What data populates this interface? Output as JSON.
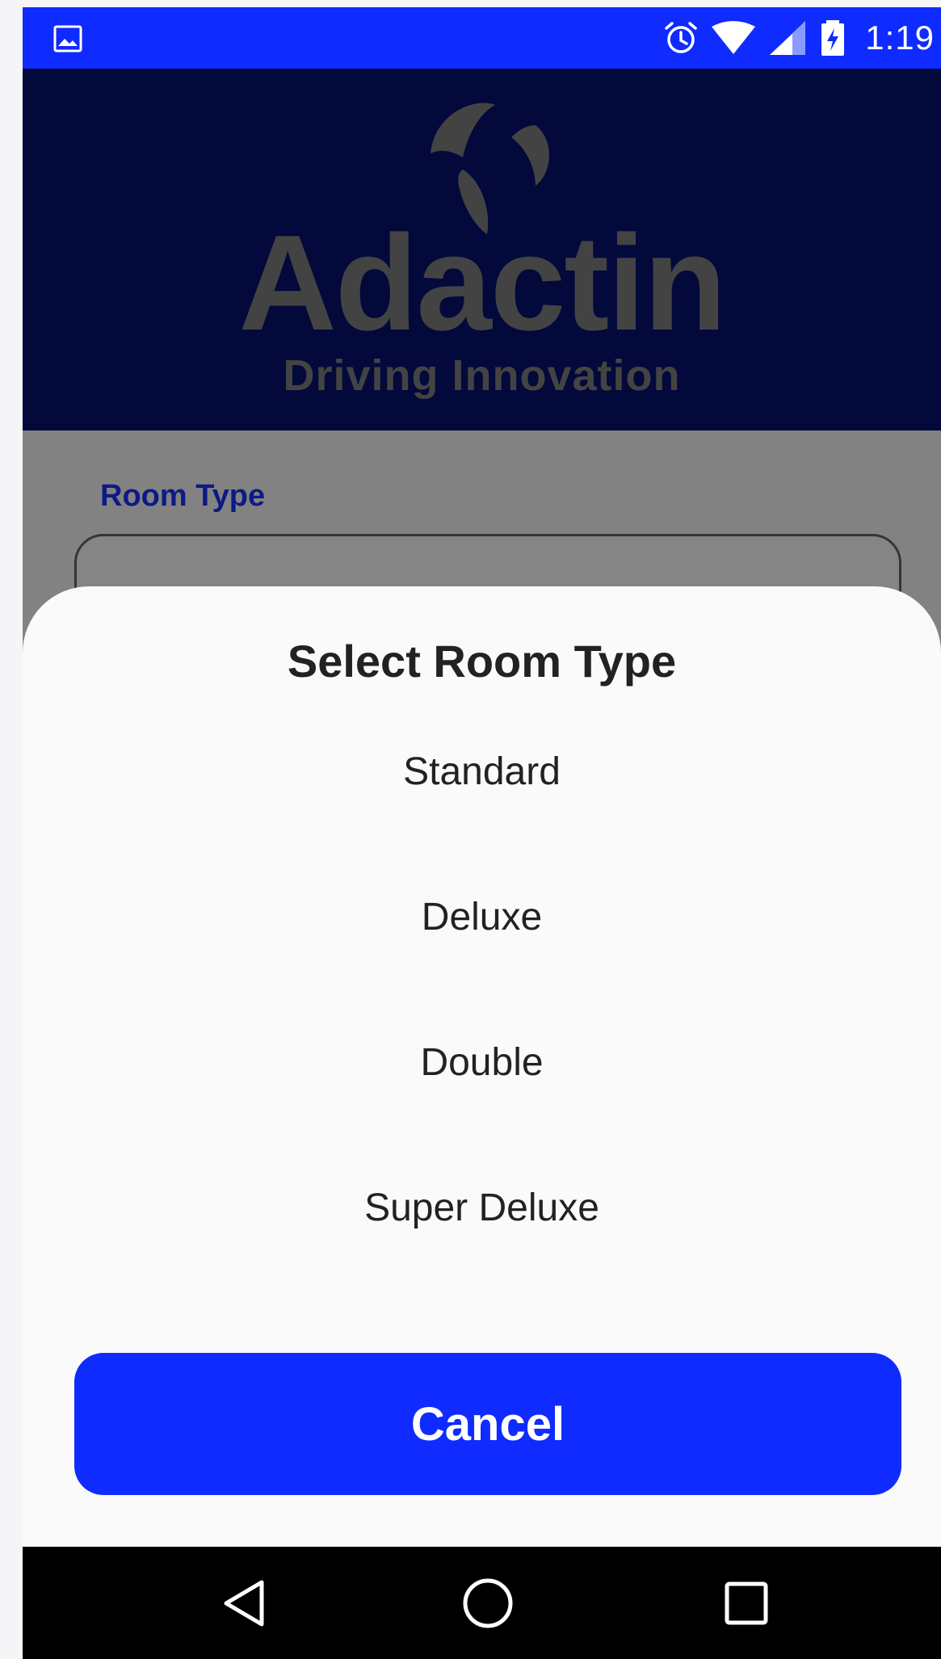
{
  "status_bar": {
    "time": "1:19",
    "icons": [
      "image-notification-icon",
      "alarm-icon",
      "wifi-icon",
      "cell-signal-icon",
      "battery-charging-icon"
    ]
  },
  "header": {
    "logo_text": "Adactin",
    "tagline": "Driving Innovation"
  },
  "form": {
    "room_type_label": "Room Type"
  },
  "sheet": {
    "title": "Select Room Type",
    "options": [
      "Standard",
      "Deluxe",
      "Double",
      "Super Deluxe"
    ],
    "cancel_label": "Cancel"
  },
  "nav_bar": {
    "icons": [
      "back-icon",
      "home-icon",
      "recents-icon"
    ]
  },
  "colors": {
    "accent": "#0f2bff",
    "header_bg": "#071371",
    "logo_gray": "#818181"
  }
}
